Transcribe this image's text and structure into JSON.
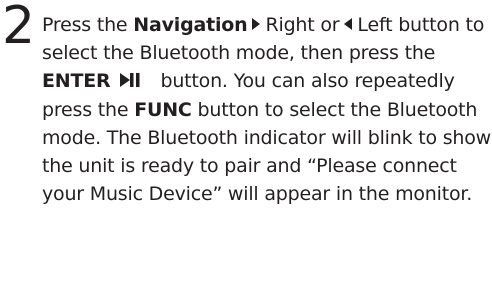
{
  "step": {
    "number": "2",
    "t1": "Press the ",
    "b1": "Navigation",
    "t2": "Right or",
    "t3": "Left button to select the Bluetooth mode, then press the ",
    "b2": "ENTER",
    "t4": "button. You can also repeatedly press the ",
    "b3": "FUNC",
    "t5": " button to select the Bluetooth mode. The Bluetooth indicator will blink to show the unit is ready to pair and “Please connect your Music Device” will appear in the monitor.",
    "icons": {
      "right": "triangle-right-icon",
      "left": "triangle-left-icon",
      "enter": "play-pause-icon"
    }
  }
}
